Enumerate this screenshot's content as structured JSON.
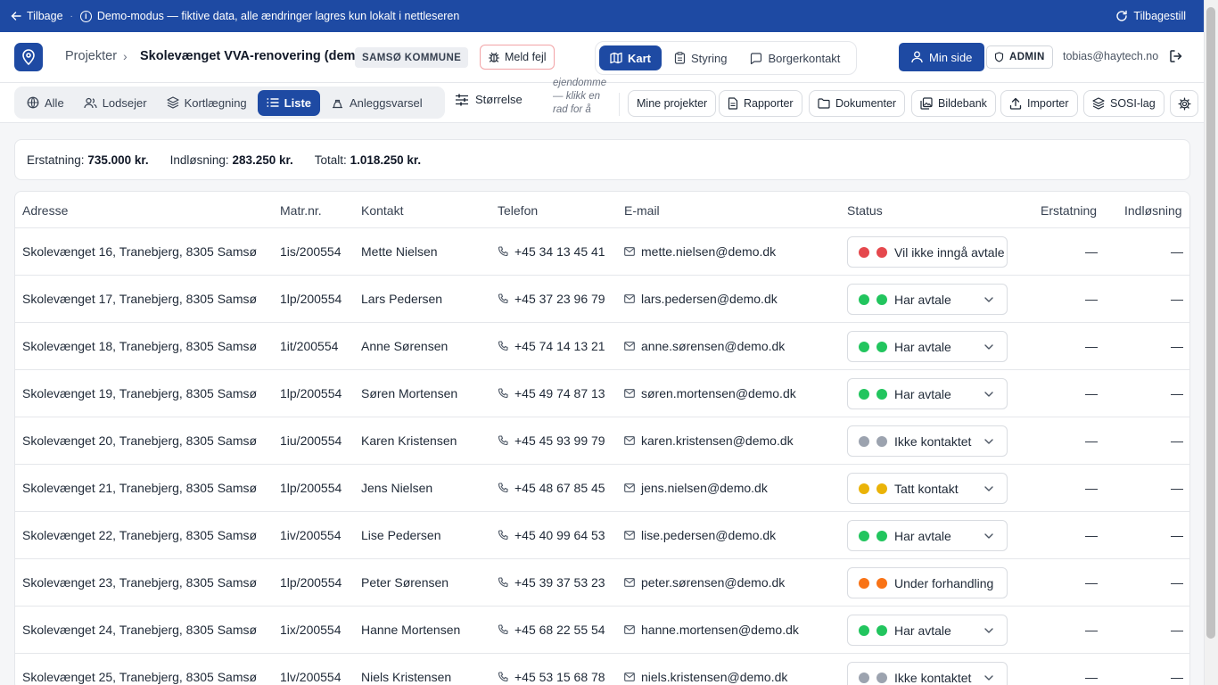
{
  "banner": {
    "back_label": "Tilbage",
    "separator": "·",
    "demo_text": "Demo-modus — fiktive data, alle ændringer lagres kun lokalt i nettleseren",
    "reset_label": "Tilbagestill"
  },
  "header": {
    "breadcrumb_root": "Projekter",
    "project_title": "Skolevænget VVA-renovering (demo)",
    "municipality": "SAMSØ KOMMUNE",
    "report_bug_label": "Meld fejl",
    "mode_tabs": [
      {
        "label": "Kart",
        "icon": "map-icon",
        "active": true
      },
      {
        "label": "Styring",
        "icon": "clipboard-icon",
        "active": false
      },
      {
        "label": "Borgerkontakt",
        "icon": "chat-icon",
        "active": false
      }
    ],
    "my_page_label": "Min side",
    "role_badge": "ADMIN",
    "user_email": "tobias@haytech.no"
  },
  "toolbar": {
    "view_tabs": [
      {
        "label": "Alle",
        "icon": "globe-icon",
        "active": false
      },
      {
        "label": "Lodsejer",
        "icon": "users-icon",
        "active": false
      },
      {
        "label": "Kortlægning",
        "icon": "layers-icon",
        "active": false
      },
      {
        "label": "Liste",
        "icon": "list-icon",
        "active": true
      },
      {
        "label": "Anleggsvarsel",
        "icon": "construction-icon",
        "active": false
      }
    ],
    "size_label": "Størrelse",
    "hint_text": "ejendomme — klikk en rad for å åpne",
    "buttons": [
      {
        "label": "Mine projekter",
        "icon": ""
      },
      {
        "label": "Rapporter",
        "icon": "report-icon"
      },
      {
        "label": "Dokumenter",
        "icon": "folder-icon"
      },
      {
        "label": "Bildebank",
        "icon": "images-icon"
      },
      {
        "label": "Importer",
        "icon": "upload-icon"
      },
      {
        "label": "SOSI-lag",
        "icon": "layers-icon"
      }
    ]
  },
  "summary": {
    "compensation_label": "Erstatning:",
    "compensation_value": "735.000 kr.",
    "redemption_label": "Indløsning:",
    "redemption_value": "283.250 kr.",
    "total_label": "Totalt:",
    "total_value": "1.018.250 kr."
  },
  "table": {
    "columns": [
      "Adresse",
      "Matr.nr.",
      "Kontakt",
      "Telefon",
      "E-mail",
      "Status",
      "Erstatning",
      "Indløsning"
    ],
    "rows": [
      {
        "address": "Skolevænget 16, Tranebjerg, 8305 Samsø",
        "matr": "1is/200554",
        "contact": "Mette Nielsen",
        "phone": "+45 34 13 45 41",
        "email": "mette.nielsen@demo.dk",
        "status": "Vil ikke inngå avtale",
        "status_color": "#e5484d",
        "compensation": "—",
        "redemption": "—"
      },
      {
        "address": "Skolevænget 17, Tranebjerg, 8305 Samsø",
        "matr": "1lp/200554",
        "contact": "Lars Pedersen",
        "phone": "+45 37 23 96 79",
        "email": "lars.pedersen@demo.dk",
        "status": "Har avtale",
        "status_color": "#22c55e",
        "compensation": "—",
        "redemption": "—"
      },
      {
        "address": "Skolevænget 18, Tranebjerg, 8305 Samsø",
        "matr": "1it/200554",
        "contact": "Anne Sørensen",
        "phone": "+45 74 14 13 21",
        "email": "anne.sørensen@demo.dk",
        "status": "Har avtale",
        "status_color": "#22c55e",
        "compensation": "—",
        "redemption": "—"
      },
      {
        "address": "Skolevænget 19, Tranebjerg, 8305 Samsø",
        "matr": "1lp/200554",
        "contact": "Søren Mortensen",
        "phone": "+45 49 74 87 13",
        "email": "søren.mortensen@demo.dk",
        "status": "Har avtale",
        "status_color": "#22c55e",
        "compensation": "—",
        "redemption": "—"
      },
      {
        "address": "Skolevænget 20, Tranebjerg, 8305 Samsø",
        "matr": "1iu/200554",
        "contact": "Karen Kristensen",
        "phone": "+45 45 93 99 79",
        "email": "karen.kristensen@demo.dk",
        "status": "Ikke kontaktet",
        "status_color": "#9ca3af",
        "compensation": "—",
        "redemption": "—"
      },
      {
        "address": "Skolevænget 21, Tranebjerg, 8305 Samsø",
        "matr": "1lp/200554",
        "contact": "Jens Nielsen",
        "phone": "+45 48 67 85 45",
        "email": "jens.nielsen@demo.dk",
        "status": "Tatt kontakt",
        "status_color": "#eab308",
        "compensation": "—",
        "redemption": "—"
      },
      {
        "address": "Skolevænget 22, Tranebjerg, 8305 Samsø",
        "matr": "1iv/200554",
        "contact": "Lise Pedersen",
        "phone": "+45 40 99 64 53",
        "email": "lise.pedersen@demo.dk",
        "status": "Har avtale",
        "status_color": "#22c55e",
        "compensation": "—",
        "redemption": "—"
      },
      {
        "address": "Skolevænget 23, Tranebjerg, 8305 Samsø",
        "matr": "1lp/200554",
        "contact": "Peter Sørensen",
        "phone": "+45 39 37 53 23",
        "email": "peter.sørensen@demo.dk",
        "status": "Under forhandling",
        "status_color": "#f97316",
        "compensation": "—",
        "redemption": "—"
      },
      {
        "address": "Skolevænget 24, Tranebjerg, 8305 Samsø",
        "matr": "1ix/200554",
        "contact": "Hanne Mortensen",
        "phone": "+45 68 22 55 54",
        "email": "hanne.mortensen@demo.dk",
        "status": "Har avtale",
        "status_color": "#22c55e",
        "compensation": "—",
        "redemption": "—"
      },
      {
        "address": "Skolevænget 25, Tranebjerg, 8305 Samsø",
        "matr": "1lv/200554",
        "contact": "Niels Kristensen",
        "phone": "+45 53 15 68 78",
        "email": "niels.kristensen@demo.dk",
        "status": "Ikke kontaktet",
        "status_color": "#9ca3af",
        "compensation": "—",
        "redemption": "—"
      }
    ]
  },
  "colors": {
    "brand": "#1e4aa3",
    "danger": "#c0262d"
  }
}
